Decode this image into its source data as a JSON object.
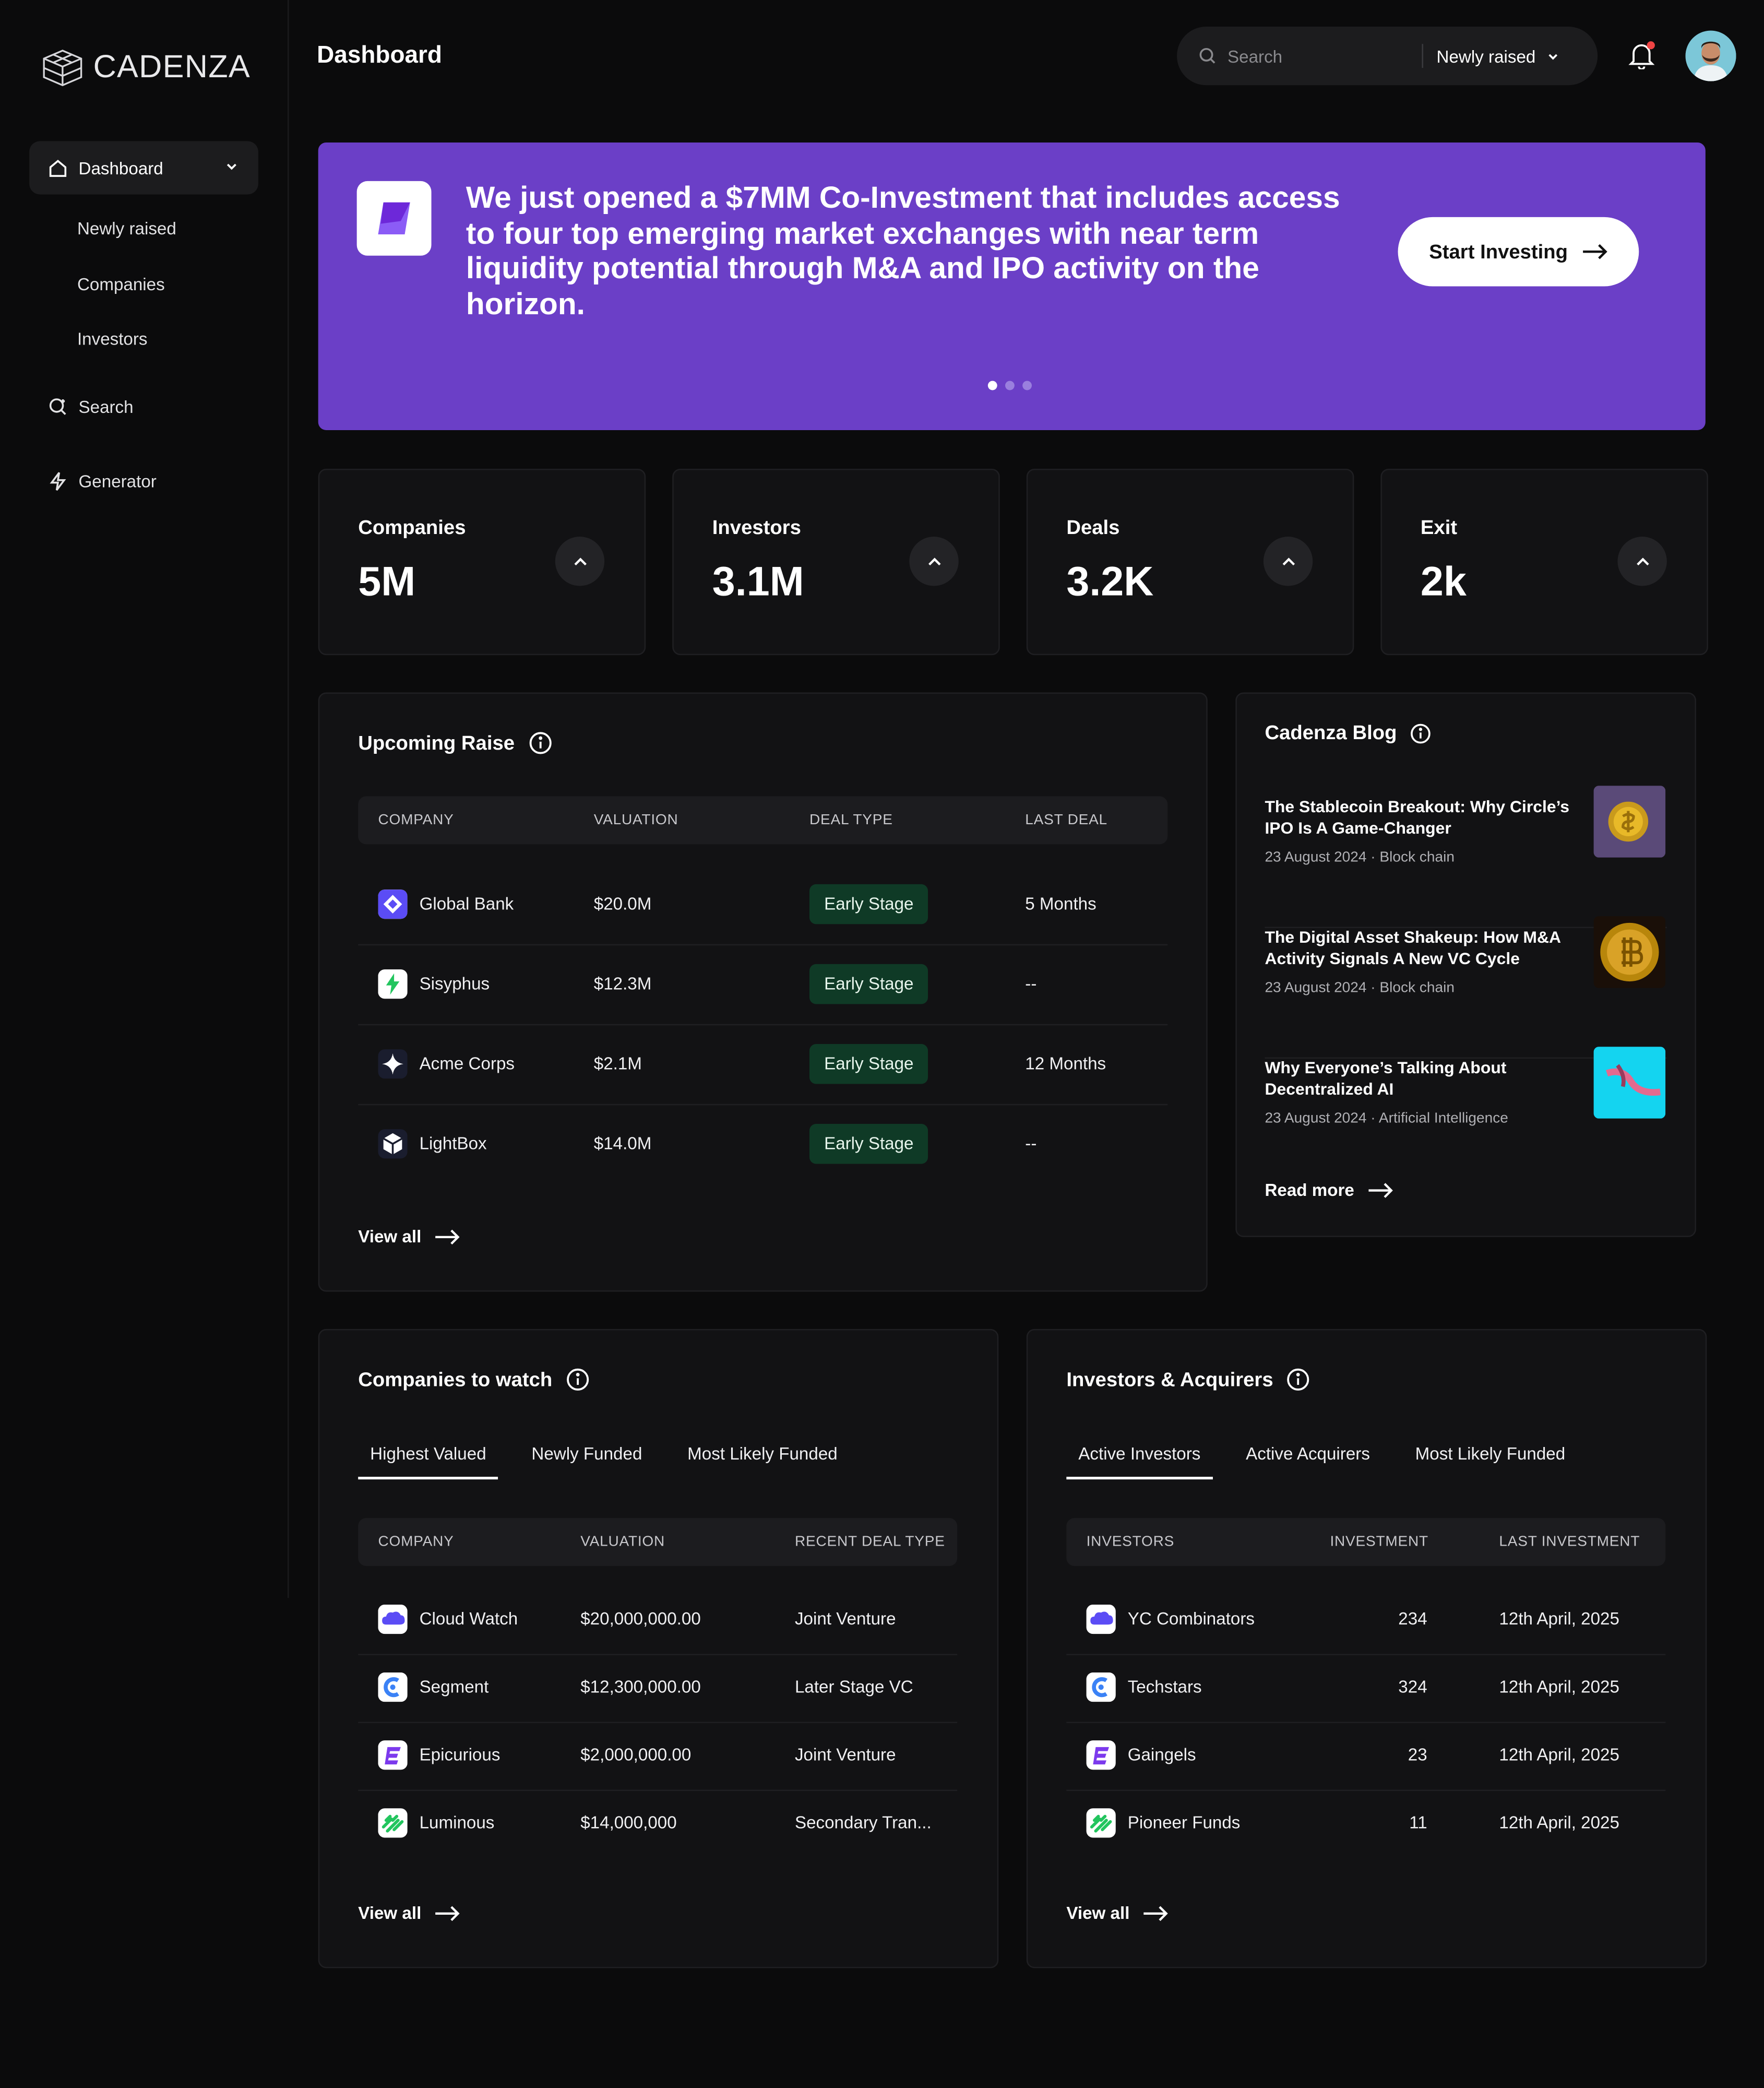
{
  "sidebar": {
    "logo": "CADENZA",
    "active_item": "Dashboard",
    "subitems": [
      "Newly raised",
      "Companies",
      "Investors"
    ],
    "items": [
      {
        "label": "Search",
        "icon": "search-sparkle-icon"
      },
      {
        "label": "Generator",
        "icon": "bolt-icon"
      }
    ]
  },
  "header": {
    "title": "Dashboard",
    "search_placeholder": "Search",
    "filter_selected": "Newly raised"
  },
  "banner": {
    "text": "We just opened a $7MM Co-Investment that includes access to four top emerging market exchanges with near term liquidity potential through M&A and IPO activity on the horizon.",
    "button": "Start Investing",
    "bg_color": "#6b3fc7"
  },
  "stats": [
    {
      "label": "Companies",
      "value": "5M"
    },
    {
      "label": "Investors",
      "value": "3.1M"
    },
    {
      "label": "Deals",
      "value": "3.2K"
    },
    {
      "label": "Exit",
      "value": "2k"
    }
  ],
  "upcoming_raise": {
    "title": "Upcoming Raise",
    "columns": [
      "COMPANY",
      "VALUATION",
      "DEAL TYPE",
      "LAST DEAL"
    ],
    "rows": [
      {
        "company": "Global Bank",
        "valuation": "$20.0M",
        "deal_type": "Early Stage",
        "last_deal": "5 Months"
      },
      {
        "company": "Sisyphus",
        "valuation": "$12.3M",
        "deal_type": "Early Stage",
        "last_deal": "--"
      },
      {
        "company": "Acme Corps",
        "valuation": "$2.1M",
        "deal_type": "Early Stage",
        "last_deal": "12 Months"
      },
      {
        "company": "LightBox",
        "valuation": "$14.0M",
        "deal_type": "Early Stage",
        "last_deal": "--"
      }
    ],
    "view_all": "View all"
  },
  "blog": {
    "title": "Cadenza Blog",
    "posts": [
      {
        "title": "The Stablecoin Breakout: Why Circle’s IPO Is A Game-Changer",
        "meta": "23 August 2024 · Block chain"
      },
      {
        "title": "The Digital Asset Shakeup: How M&A Activity Signals A New VC Cycle",
        "meta": "23 August 2024 · Block chain"
      },
      {
        "title": "Why Everyone’s Talking About Decentralized AI",
        "meta": "23 August 2024 · Artificial Intelligence"
      }
    ],
    "read_more": "Read more"
  },
  "companies_to_watch": {
    "title": "Companies to watch",
    "tabs": [
      "Highest Valued",
      "Newly Funded",
      "Most Likely Funded"
    ],
    "columns": [
      "COMPANY",
      "VALUATION",
      "RECENT DEAL TYPE"
    ],
    "rows": [
      {
        "company": "Cloud Watch",
        "valuation": "$20,000,000.00",
        "deal_type": "Joint Venture"
      },
      {
        "company": "Segment",
        "valuation": "$12,300,000.00",
        "deal_type": "Later Stage VC"
      },
      {
        "company": "Epicurious",
        "valuation": "$2,000,000.00",
        "deal_type": "Joint Venture"
      },
      {
        "company": "Luminous",
        "valuation": "$14,000,000",
        "deal_type": "Secondary Tran..."
      }
    ],
    "view_all": "View all"
  },
  "investors_acquirers": {
    "title": "Investors & Acquirers",
    "tabs": [
      "Active Investors",
      "Active Acquirers",
      "Most Likely Funded"
    ],
    "columns": [
      "INVESTORS",
      "INVESTMENT",
      "LAST INVESTMENT"
    ],
    "rows": [
      {
        "investor": "YC Combinators",
        "investment": "234",
        "last": "12th April, 2025"
      },
      {
        "investor": "Techstars",
        "investment": "324",
        "last": "12th April, 2025"
      },
      {
        "investor": "Gaingels",
        "investment": "23",
        "last": "12th April, 2025"
      },
      {
        "investor": "Pioneer Funds",
        "investment": "11",
        "last": "12th April, 2025"
      }
    ],
    "view_all": "View all"
  }
}
